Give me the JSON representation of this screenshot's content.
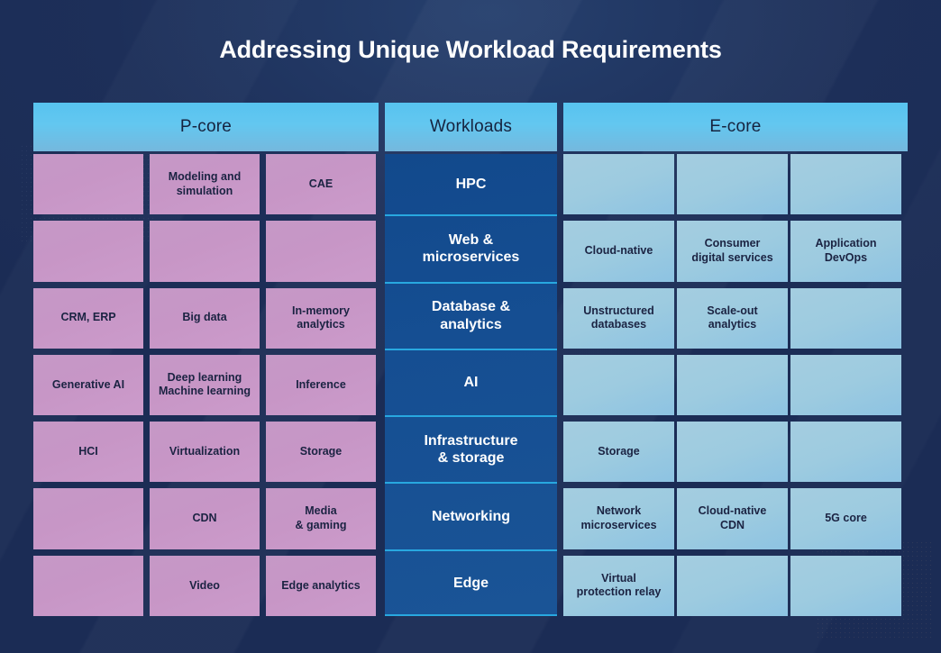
{
  "page": {
    "title": "Addressing Unique Workload Requirements",
    "background_color": "#1b2c55",
    "accent_color": "#63c7f0",
    "pcore_cell_color": "#c796c6",
    "ecore_cell_color": "#9dcbe0",
    "workload_panel_color": "#154e92",
    "workload_rule_color": "#28a8e0"
  },
  "table": {
    "headers": {
      "pcore": "P-core",
      "workloads": "Workloads",
      "ecore": "E-core"
    },
    "rows": [
      {
        "workload": "HPC",
        "pcore": [
          "",
          "Modeling and\nsimulation",
          "CAE"
        ],
        "ecore": [
          "",
          "",
          ""
        ]
      },
      {
        "workload": "Web &\nmicroservices",
        "pcore": [
          "",
          "",
          ""
        ],
        "ecore": [
          "Cloud-native",
          "Consumer\ndigital services",
          "Application\nDevOps"
        ]
      },
      {
        "workload": "Database &\nanalytics",
        "pcore": [
          "CRM, ERP",
          "Big data",
          "In-memory\nanalytics"
        ],
        "ecore": [
          "Unstructured\ndatabases",
          "Scale-out\nanalytics",
          ""
        ]
      },
      {
        "workload": "AI",
        "pcore": [
          "Generative AI",
          "Deep learning\nMachine learning",
          "Inference"
        ],
        "ecore": [
          "",
          "",
          ""
        ]
      },
      {
        "workload": "Infrastructure\n& storage",
        "pcore": [
          "HCI",
          "Virtualization",
          "Storage"
        ],
        "ecore": [
          "Storage",
          "",
          ""
        ]
      },
      {
        "workload": "Networking",
        "pcore": [
          "",
          "CDN",
          "Media\n& gaming"
        ],
        "ecore": [
          "Network\nmicroservices",
          "Cloud-native\nCDN",
          "5G core"
        ]
      },
      {
        "workload": "Edge",
        "pcore": [
          "",
          "Video",
          "Edge analytics"
        ],
        "ecore": [
          "Virtual\nprotection relay",
          "",
          ""
        ]
      }
    ]
  }
}
